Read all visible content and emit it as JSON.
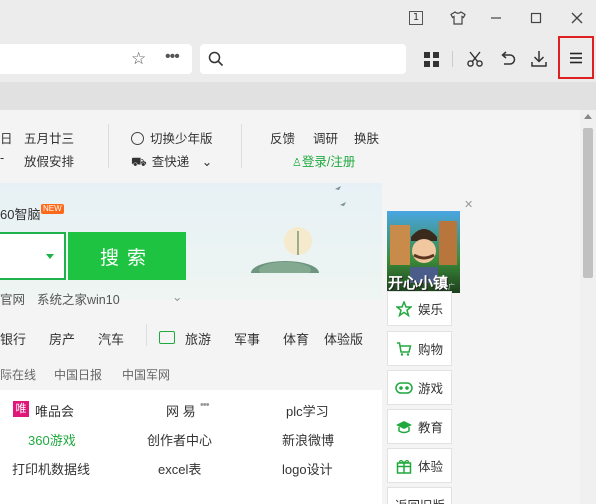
{
  "window": {
    "tab_count": "1"
  },
  "toolbar": {
    "menu_highlight_color": "#e02020"
  },
  "page": {
    "info_bar": {
      "date": "日",
      "lunar_date": "五月廿三",
      "holiday": "放假安排",
      "switch_mode": "切换少年版",
      "express": "查快递",
      "feedback": "反馈",
      "research": "调研",
      "skin": "换肤",
      "login": "登录/注册"
    },
    "hero": {
      "brand": "60智脑",
      "new_badge": "NEW",
      "search_button": "搜索",
      "hints": [
        "官网",
        "系统之家win10"
      ]
    },
    "nav": [
      "银行",
      "房产",
      "汽车",
      "旅游",
      "军事",
      "体育",
      "体验版"
    ],
    "sub_nav": [
      "际在线",
      "中国日报",
      "中国军网"
    ],
    "links": [
      [
        "唯品会",
        "网 易",
        "plc学习"
      ],
      [
        "360游戏",
        "创作者中心",
        "新浪微博"
      ],
      [
        "打印机数据线",
        "excel表",
        "logo设计"
      ]
    ],
    "ad": {
      "title": "开心小镇",
      "tag": "广告"
    },
    "side_menu": [
      "娱乐",
      "购物",
      "游戏",
      "教育",
      "体验",
      "返回旧版"
    ]
  }
}
